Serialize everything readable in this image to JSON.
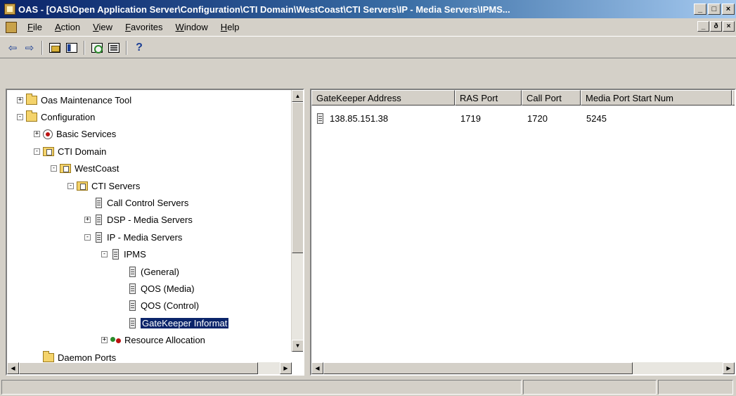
{
  "window": {
    "title": "OAS - [OAS\\Open Application Server\\Configuration\\CTI Domain\\WestCoast\\CTI Servers\\IP - Media Servers\\IPMS...",
    "minimize_label": "_",
    "maximize_label": "□",
    "close_label": "×"
  },
  "menubar": {
    "items": [
      "File",
      "Action",
      "View",
      "Favorites",
      "Window",
      "Help"
    ],
    "mdi_minimize": "_",
    "mdi_restore": "ð",
    "mdi_close": "×"
  },
  "toolbar": {
    "back_icon": "arrow-left-icon",
    "forward_icon": "arrow-right-icon",
    "back_glyph": "⇦",
    "forward_glyph": "⇨",
    "help_glyph": "?"
  },
  "tree": {
    "nodes": [
      {
        "label": "Oas Maintenance Tool",
        "icon": "folder",
        "expander": "+",
        "depth": 0
      },
      {
        "label": "Configuration",
        "icon": "folder",
        "expander": "−",
        "depth": 0
      },
      {
        "label": "Basic Services",
        "icon": "services",
        "expander": "+",
        "depth": 1
      },
      {
        "label": "CTI Domain",
        "icon": "domain",
        "expander": "−",
        "depth": 1
      },
      {
        "label": "WestCoast",
        "icon": "domain",
        "expander": "−",
        "depth": 2
      },
      {
        "label": "CTI Servers",
        "icon": "domain",
        "expander": "−",
        "depth": 3
      },
      {
        "label": "Call Control Servers",
        "icon": "server",
        "expander": "",
        "depth": 4
      },
      {
        "label": "DSP - Media Servers",
        "icon": "server",
        "expander": "+",
        "depth": 4
      },
      {
        "label": "IP - Media Servers",
        "icon": "server",
        "expander": "−",
        "depth": 4
      },
      {
        "label": "IPMS",
        "icon": "server",
        "expander": "−",
        "depth": 5
      },
      {
        "label": "(General)",
        "icon": "server",
        "expander": "",
        "depth": 6
      },
      {
        "label": "QOS (Media)",
        "icon": "server",
        "expander": "",
        "depth": 6
      },
      {
        "label": "QOS (Control)",
        "icon": "server",
        "expander": "",
        "depth": 6
      },
      {
        "label": "GateKeeper Informat",
        "icon": "server",
        "expander": "",
        "depth": 6,
        "selected": true
      },
      {
        "label": "Resource Allocation",
        "icon": "resource",
        "expander": "+",
        "depth": 5
      },
      {
        "label": "Daemon Ports",
        "icon": "folder",
        "expander": "",
        "depth": 1
      }
    ]
  },
  "list": {
    "columns": [
      "GateKeeper Address",
      "RAS Port",
      "Call Port",
      "Media Port Start Num",
      ""
    ],
    "rows": [
      {
        "icon": "server-icon",
        "gatekeeper_address": "138.85.151.38",
        "ras_port": "1719",
        "call_port": "1720",
        "media_port_start_num": "5245"
      }
    ]
  },
  "statusbar": {
    "panels": [
      "",
      "",
      ""
    ]
  }
}
